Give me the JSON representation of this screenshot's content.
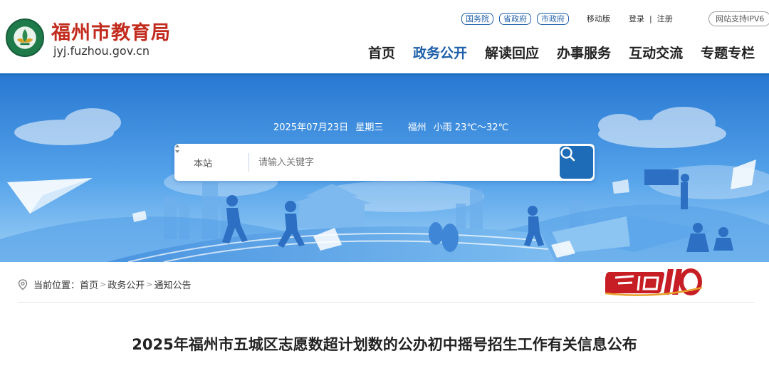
{
  "site": {
    "name": "福州市教育局",
    "domain_prefix": "jyj",
    "domain_rest": ".fuzhou.gov.cn"
  },
  "top_links": {
    "gov_tags": [
      "国务院",
      "省政府",
      "市政府"
    ],
    "mobile": "移动版",
    "login": "登录",
    "separator": "|",
    "register": "注册",
    "ipv6": "网站支持IPV6"
  },
  "nav": {
    "items": [
      "首页",
      "政务公开",
      "解读回应",
      "办事服务",
      "互动交流",
      "专题专栏"
    ],
    "active_index": 1
  },
  "banner": {
    "date": "2025年07月23日",
    "weekday": "星期三",
    "city": "福州",
    "weather": "小雨 23℃～32℃"
  },
  "search": {
    "scope": "本站",
    "placeholder": "请输入关键字",
    "icon": "search-icon"
  },
  "breadcrumb": {
    "label": "当前位置：",
    "items": [
      "首页",
      "政务公开",
      "通知公告"
    ],
    "separator": ">"
  },
  "article": {
    "title": "2025年福州市五城区志愿数超计划数的公办初中摇号招生工作有关信息公布"
  },
  "colors": {
    "brand_red": "#c22c1e",
    "nav_active": "#1d5fa8",
    "banner_blue": "#2f82d8",
    "search_button": "#1e6cb8"
  }
}
